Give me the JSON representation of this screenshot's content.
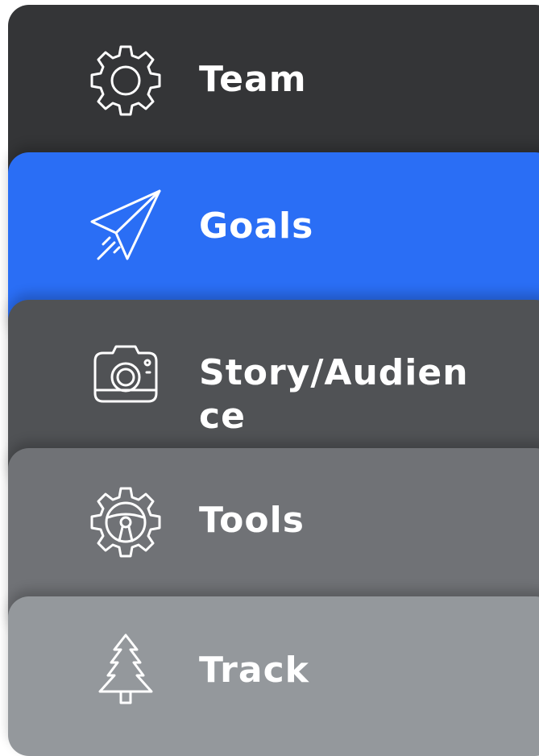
{
  "menu": {
    "items": [
      {
        "label": "Team",
        "icon": "gear-icon",
        "color": "#343537"
      },
      {
        "label": "Goals",
        "icon": "paper-plane-icon",
        "color": "#2a6ef5"
      },
      {
        "label": "Story/Audience",
        "icon": "camera-icon",
        "color": "#505255"
      },
      {
        "label": "Tools",
        "icon": "steering-wheel-gear-icon",
        "color": "#707276"
      },
      {
        "label": "Track",
        "icon": "pine-tree-icon",
        "color": "#94989c"
      }
    ],
    "active_item": "Goals"
  }
}
